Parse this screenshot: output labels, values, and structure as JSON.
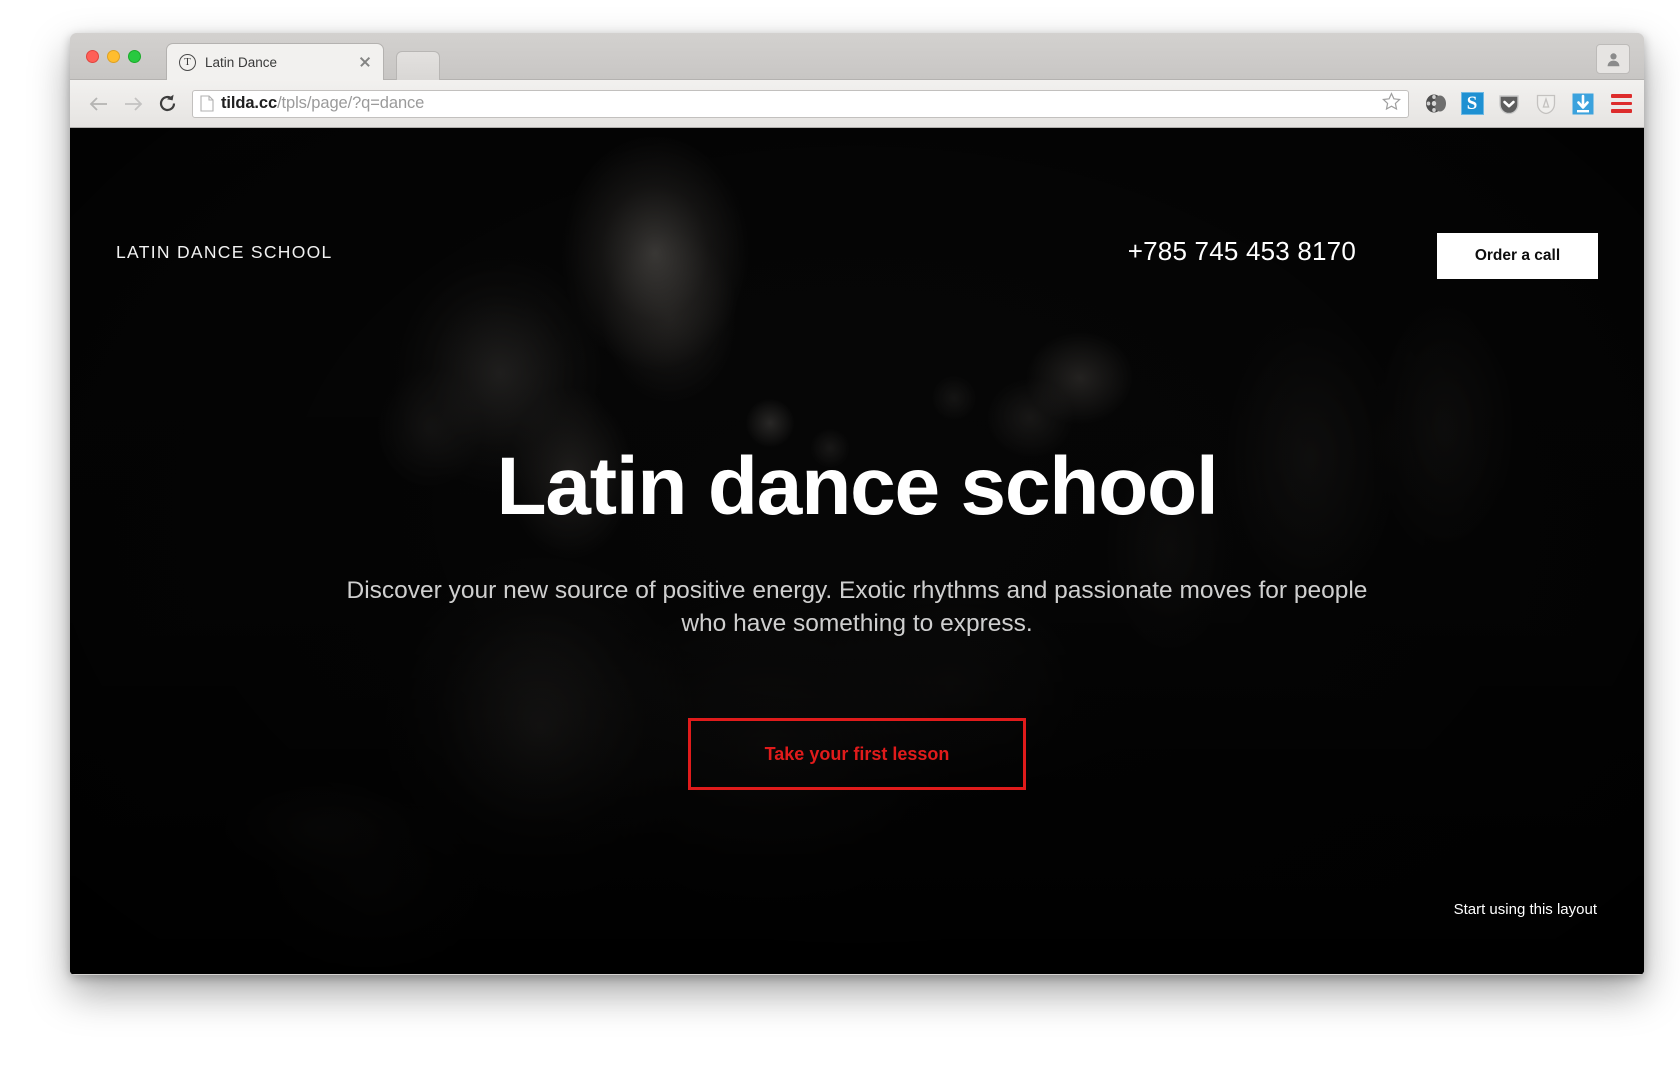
{
  "browser": {
    "tab": {
      "title": "Latin Dance",
      "favicon_glyph": "T",
      "favicon_name": "tilda-favicon",
      "close_label": "×"
    },
    "new_tab_label": "",
    "toolbar": {
      "back_label": "Back",
      "forward_label": "Forward",
      "reload_label": "Reload",
      "url_host": "tilda.cc",
      "url_path": "/tpls/page/?q=dance",
      "bookmark_label": "Bookmark this page",
      "extensions": [
        {
          "name": "film-reel-icon",
          "label": "Video Downloader"
        },
        {
          "name": "skype-icon",
          "label": "S"
        },
        {
          "name": "pocket-icon",
          "label": "Pocket"
        },
        {
          "name": "shield-icon",
          "label": "Shield"
        },
        {
          "name": "download-arrow-icon",
          "label": "Download"
        }
      ],
      "menu_label": "Chrome menu"
    },
    "profile_label": "Profile"
  },
  "page": {
    "brand": "LATIN DANCE SCHOOL",
    "phone": "+785 745 453 8170",
    "order_call": "Order a call",
    "title": "Latin dance school",
    "subtitle": "Discover your new source of positive energy. Exotic rhythms and passionate moves for people who have something to express.",
    "cta": "Take your first lesson",
    "layout_link": "Start using this layout",
    "colors": {
      "accent_red": "#e01b1b",
      "hero_background": "#0c0c0c",
      "button_white": "#ffffff",
      "subtitle_gray": "#cfcfcf"
    }
  }
}
